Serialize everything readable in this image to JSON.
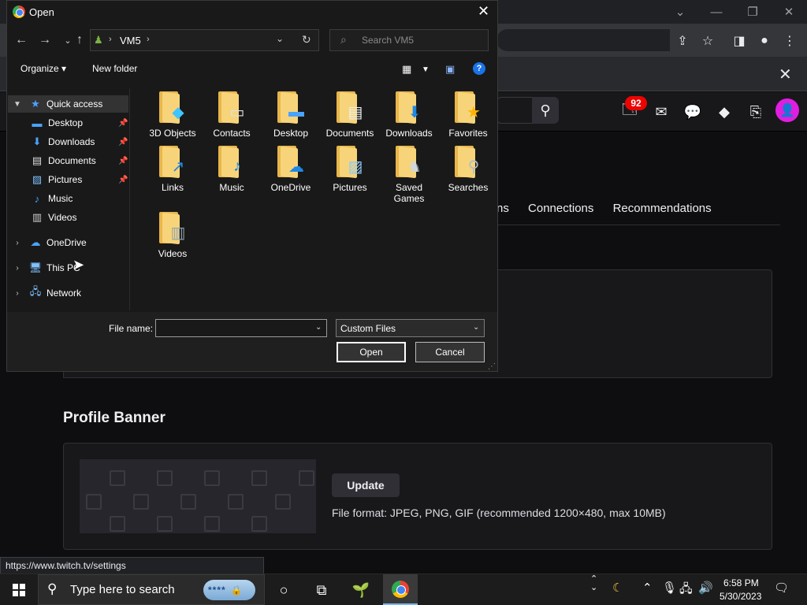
{
  "dialog": {
    "title": "Open",
    "address_path": "VM5",
    "search_placeholder": "Search VM5",
    "organize_label": "Organize",
    "new_folder_label": "New folder",
    "nav": {
      "quick_access": "Quick access",
      "desktop": "Desktop",
      "downloads": "Downloads",
      "documents": "Documents",
      "pictures": "Pictures",
      "music": "Music",
      "videos": "Videos",
      "onedrive": "OneDrive",
      "this_pc": "This PC",
      "network": "Network"
    },
    "files": {
      "objects3d": "3D Objects",
      "contacts": "Contacts",
      "desktop": "Desktop",
      "documents": "Documents",
      "downloads": "Downloads",
      "favorites": "Favorites",
      "links": "Links",
      "music": "Music",
      "onedrive": "OneDrive",
      "pictures": "Pictures",
      "saved_games_1": "Saved",
      "saved_games_2": "Games",
      "searches": "Searches",
      "videos": "Videos"
    },
    "file_name_label": "File name:",
    "file_name_value": "",
    "file_type_value": "Custom Files",
    "open_label": "Open",
    "cancel_label": "Cancel"
  },
  "twitch": {
    "notification_count": "92",
    "tab_partial": "ns",
    "tab_connections": "Connections",
    "tab_recommendations": "Recommendations",
    "banner_heading": "Profile Banner",
    "update_label": "Update",
    "file_format": "File format: JPEG, PNG, GIF (recommended 1200×480, max 10MB)"
  },
  "status_url": "https://www.twitch.tv/settings",
  "taskbar": {
    "search_placeholder": "Type here to search",
    "pw_mask": "****",
    "time": "6:58 PM",
    "date": "5/30/2023"
  },
  "colors": {
    "twitch_purple": "#9147ff",
    "badge_red": "#eb0400",
    "avatar_pink": "#e01ee0",
    "folder_yellow": "#f7d47a"
  }
}
